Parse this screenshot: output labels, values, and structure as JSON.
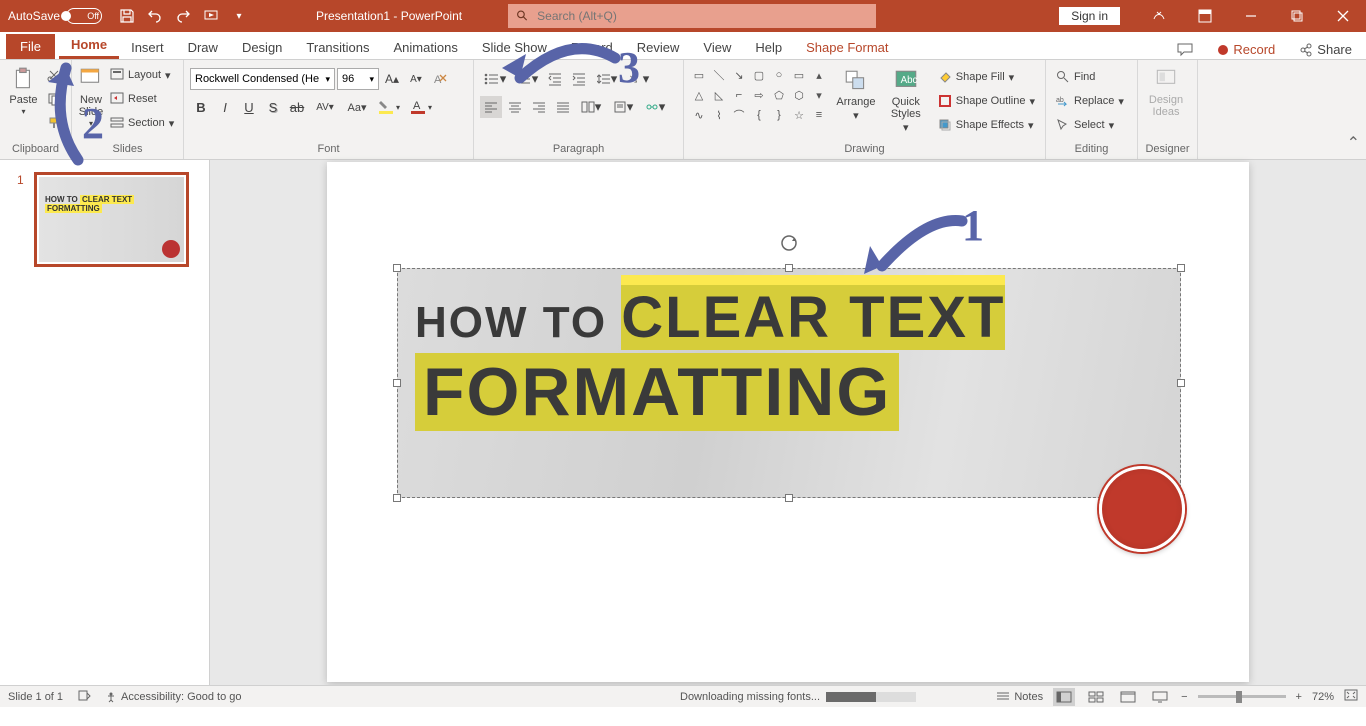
{
  "titlebar": {
    "autosave_label": "AutoSave",
    "autosave_state": "Off",
    "doc_title": "Presentation1 - PowerPoint",
    "search_placeholder": "Search (Alt+Q)",
    "signin": "Sign in"
  },
  "tabs": {
    "file": "File",
    "home": "Home",
    "insert": "Insert",
    "draw": "Draw",
    "design": "Design",
    "transitions": "Transitions",
    "animations": "Animations",
    "slideshow": "Slide Show",
    "record": "Record",
    "review": "Review",
    "view": "View",
    "help": "Help",
    "shapefmt": "Shape Format",
    "comments": "",
    "record_btn": "Record",
    "share": "Share"
  },
  "ribbon": {
    "clipboard": {
      "paste": "Paste",
      "label": "Clipboard"
    },
    "slides": {
      "new": "New\nSlide",
      "layout": "Layout",
      "reset": "Reset",
      "section": "Section",
      "label": "Slides"
    },
    "font": {
      "name": "Rockwell Condensed (He",
      "size": "96",
      "label": "Font"
    },
    "paragraph": {
      "label": "Paragraph"
    },
    "drawing": {
      "arrange": "Arrange",
      "quick": "Quick\nStyles",
      "fill": "Shape Fill",
      "outline": "Shape Outline",
      "effects": "Shape Effects",
      "label": "Drawing"
    },
    "editing": {
      "find": "Find",
      "replace": "Replace",
      "select": "Select",
      "label": "Editing"
    },
    "designer": {
      "ideas": "Design\nIdeas",
      "label": "Designer"
    }
  },
  "thumb": {
    "num": "1",
    "text_a": "HOW TO ",
    "text_b": "CLEAR TEXT",
    "text_c": "FORMATTING"
  },
  "slide": {
    "how": "HOW TO ",
    "clear": "CLEAR TEXT",
    "fmt": "FORMATTING"
  },
  "annot": {
    "n1": "1",
    "n2": "2",
    "n3": "3"
  },
  "status": {
    "slide": "Slide 1 of 1",
    "access": "Accessibility: Good to go",
    "download": "Downloading missing fonts...",
    "notes": "Notes",
    "zoom": "72%"
  }
}
